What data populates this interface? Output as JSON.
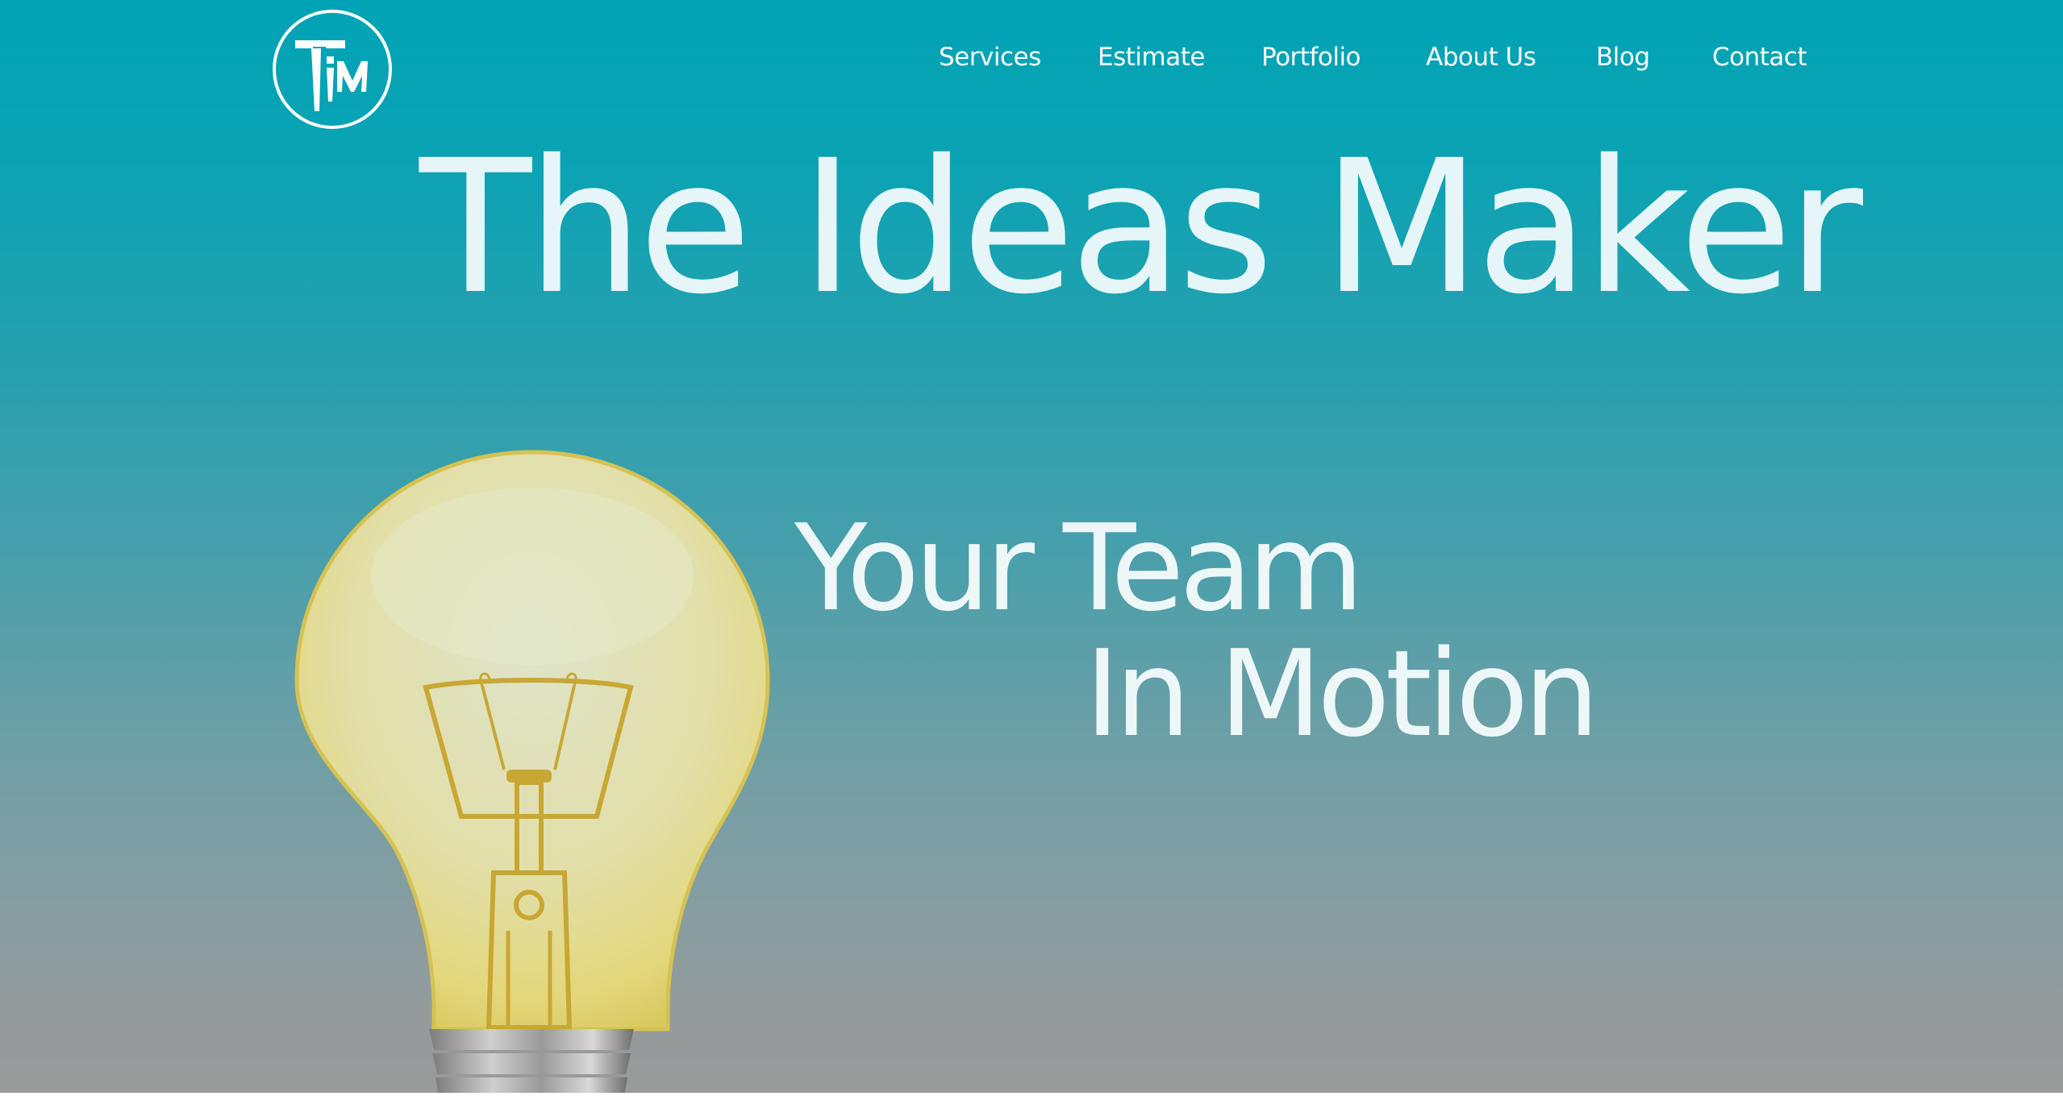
{
  "brand": {
    "logo_text": "TiM",
    "logo_icon": "tim-logo-icon"
  },
  "nav": {
    "items": [
      {
        "label": "Services"
      },
      {
        "label": "Estimate"
      },
      {
        "label": "Portfolio"
      },
      {
        "label": "About Us"
      },
      {
        "label": "Blog"
      },
      {
        "label": "Contact"
      }
    ]
  },
  "hero": {
    "title": "The Ideas Maker",
    "tagline_line1": "Your Team",
    "tagline_line2": "In Motion",
    "image_icon": "light-bulb-illustration"
  },
  "colors": {
    "gradient_top": "#00a3b5",
    "gradient_bottom": "#9a9a9a",
    "text": "#ffffff",
    "bulb_glass": "#e3dc8a",
    "bulb_filament": "#c9a733",
    "bulb_base": "#9a9a9a"
  }
}
